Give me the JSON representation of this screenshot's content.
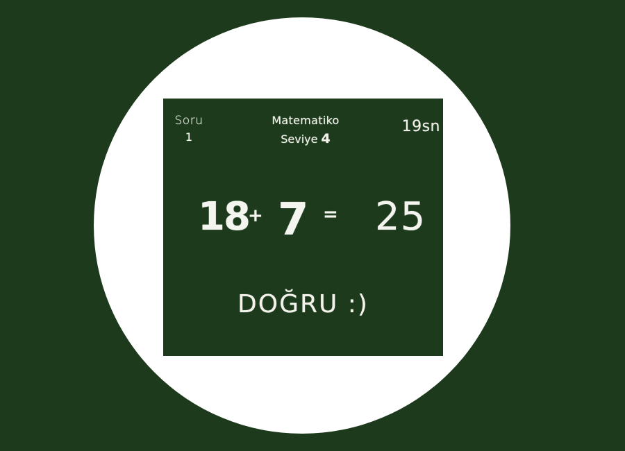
{
  "header": {
    "question_label": "Soru",
    "question_number": "1",
    "app_title": "Matematiko",
    "level_label": "Seviye",
    "level_number": "4",
    "timer": "19sn"
  },
  "equation": {
    "operand_a": "18",
    "operator": "+",
    "operand_b": "7",
    "equals": "=",
    "answer": "25"
  },
  "result_text": "DOĞRU :)",
  "colors": {
    "page_background": "#1e3a1c",
    "circle": "#ffffff",
    "chalkboard": "#1d3b1c",
    "chalk": "#f3f3ec"
  }
}
